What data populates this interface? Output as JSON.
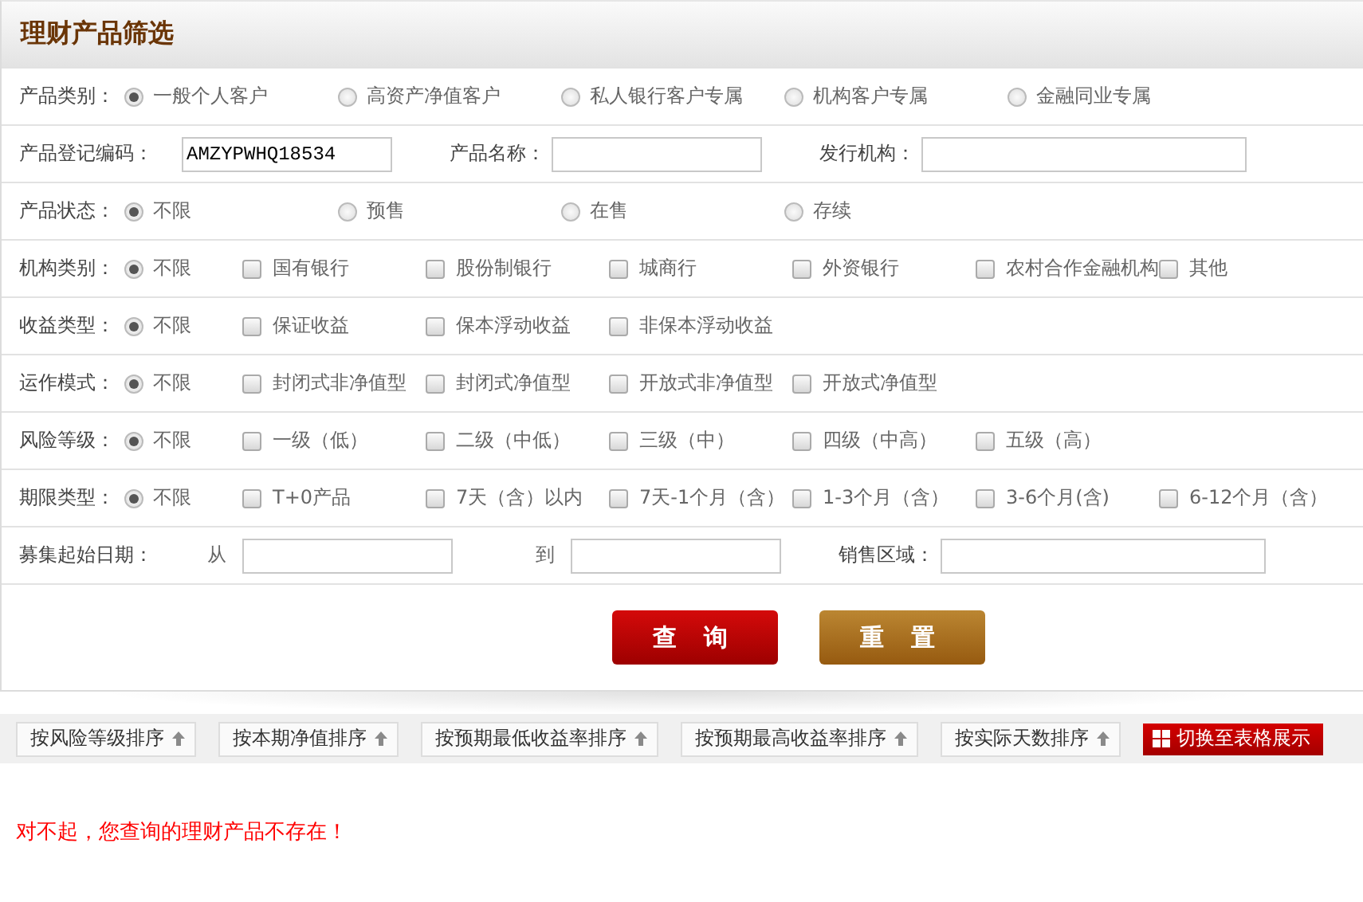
{
  "panel": {
    "title": "理财产品筛选",
    "rows": [
      {
        "kind": "options",
        "label": "产品类别：",
        "options": [
          {
            "kind": "radio",
            "label": "一般个人客户",
            "selected": true
          },
          {
            "kind": "radio",
            "label": "高资产净值客户",
            "selected": false
          },
          {
            "kind": "radio",
            "label": "私人银行客户专属",
            "selected": false
          },
          {
            "kind": "radio",
            "label": "机构客户专属",
            "selected": false
          },
          {
            "kind": "radio",
            "label": "金融同业专属",
            "selected": false
          }
        ]
      },
      {
        "kind": "fields",
        "label": "产品登记编码：",
        "fields": [
          {
            "value": "AMZYPWHQ18534"
          },
          {
            "label": "产品名称："
          },
          {
            "label": "发行机构："
          }
        ]
      },
      {
        "kind": "options",
        "label": "产品状态：",
        "options": [
          {
            "kind": "radio",
            "label": "不限",
            "selected": true
          },
          {
            "kind": "radio",
            "label": "预售",
            "selected": false
          },
          {
            "kind": "radio",
            "label": "在售",
            "selected": false
          },
          {
            "kind": "radio",
            "label": "存续",
            "selected": false
          }
        ]
      },
      {
        "kind": "options",
        "label": "机构类别：",
        "options": [
          {
            "kind": "radio",
            "label": "不限",
            "selected": true
          },
          {
            "kind": "checkbox",
            "label": "国有银行",
            "checked": false
          },
          {
            "kind": "checkbox",
            "label": "股份制银行",
            "checked": false
          },
          {
            "kind": "checkbox",
            "label": "城商行",
            "checked": false
          },
          {
            "kind": "checkbox",
            "label": "外资银行",
            "checked": false
          },
          {
            "kind": "checkbox",
            "label": "农村合作金融机构",
            "checked": false
          },
          {
            "kind": "checkbox",
            "label": "其他",
            "checked": false
          }
        ]
      },
      {
        "kind": "options",
        "label": "收益类型：",
        "options": [
          {
            "kind": "radio",
            "label": "不限",
            "selected": true
          },
          {
            "kind": "checkbox",
            "label": "保证收益",
            "checked": false
          },
          {
            "kind": "checkbox",
            "label": "保本浮动收益",
            "checked": false
          },
          {
            "kind": "checkbox",
            "label": "非保本浮动收益",
            "checked": false
          }
        ]
      },
      {
        "kind": "options",
        "label": "运作模式：",
        "options": [
          {
            "kind": "radio",
            "label": "不限",
            "selected": true
          },
          {
            "kind": "checkbox",
            "label": "封闭式非净值型",
            "checked": false
          },
          {
            "kind": "checkbox",
            "label": "封闭式净值型",
            "checked": false
          },
          {
            "kind": "checkbox",
            "label": "开放式非净值型",
            "checked": false
          },
          {
            "kind": "checkbox",
            "label": "开放式净值型",
            "checked": false
          }
        ]
      },
      {
        "kind": "options",
        "label": "风险等级：",
        "options": [
          {
            "kind": "radio",
            "label": "不限",
            "selected": true
          },
          {
            "kind": "checkbox",
            "label": "一级（低）",
            "checked": false
          },
          {
            "kind": "checkbox",
            "label": "二级（中低）",
            "checked": false
          },
          {
            "kind": "checkbox",
            "label": "三级（中）",
            "checked": false
          },
          {
            "kind": "checkbox",
            "label": "四级（中高）",
            "checked": false
          },
          {
            "kind": "checkbox",
            "label": "五级（高）",
            "checked": false
          }
        ]
      },
      {
        "kind": "options",
        "label": "期限类型：",
        "options": [
          {
            "kind": "radio",
            "label": "不限",
            "selected": true
          },
          {
            "kind": "checkbox",
            "label": "T+0产品",
            "checked": false
          },
          {
            "kind": "checkbox",
            "label": "7天（含）以内",
            "checked": false
          },
          {
            "kind": "checkbox",
            "label": "7天-1个月（含）",
            "checked": false
          },
          {
            "kind": "checkbox",
            "label": "1-3个月（含）",
            "checked": false
          },
          {
            "kind": "checkbox",
            "label": "3-6个月(含)",
            "checked": false
          },
          {
            "kind": "checkbox",
            "label": "6-12个月（含）",
            "checked": false
          }
        ]
      },
      {
        "kind": "fields",
        "label": "募集起始日期：",
        "fields": [
          {
            "prefix": "从"
          },
          {
            "prefix": "到"
          },
          {
            "label": "销售区域："
          }
        ]
      }
    ],
    "buttons": [
      {
        "kind": "search",
        "label": "查 询"
      },
      {
        "kind": "reset",
        "label": "重 置"
      }
    ]
  },
  "sort_bar": {
    "buttons": [
      "按风险等级排序",
      "按本期净值排序",
      "按预期最低收益率排序",
      "按预期最高收益率排序",
      "按实际天数排序"
    ],
    "switch_button": "切换至表格展示"
  },
  "message": "对不起，您查询的理财产品不存在！"
}
